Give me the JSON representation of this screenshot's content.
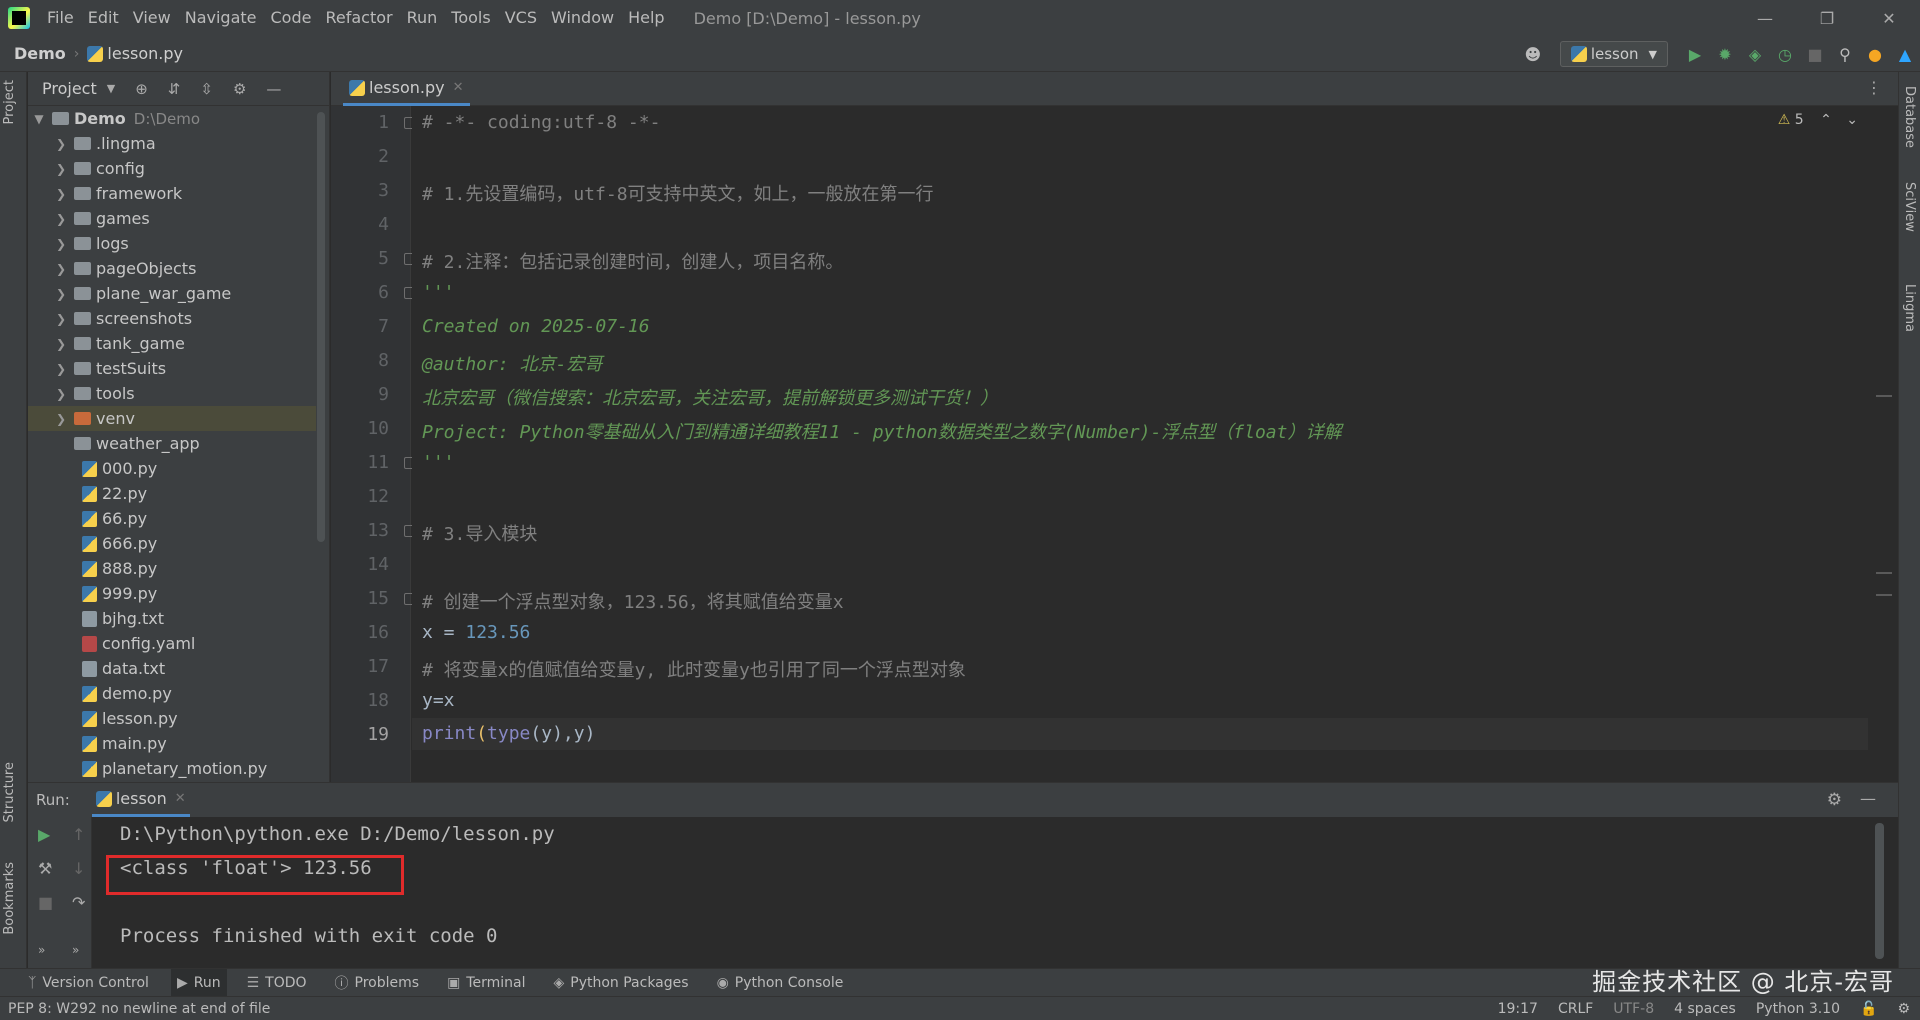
{
  "window": {
    "title": "Demo [D:\\Demo] - lesson.py",
    "menu": [
      "File",
      "Edit",
      "View",
      "Navigate",
      "Code",
      "Refactor",
      "Run",
      "Tools",
      "VCS",
      "Window",
      "Help"
    ]
  },
  "navbar": {
    "project": "Demo",
    "file": "lesson.py",
    "run_config": "lesson"
  },
  "left_strip": {
    "project": "Project",
    "structure": "Structure",
    "bookmarks": "Bookmarks"
  },
  "right_strip": {
    "database": "Database",
    "sciview": "SciView",
    "lingma": "Lingma"
  },
  "project_panel": {
    "title": "Project",
    "root_name": "Demo",
    "root_path": "D:\\Demo",
    "folders": [
      ".lingma",
      "config",
      "framework",
      "games",
      "logs",
      "pageObjects",
      "plane_war_game",
      "screenshots",
      "tank_game",
      "testSuits",
      "tools",
      "venv",
      "weather_app"
    ],
    "files": [
      "000.py",
      "22.py",
      "66.py",
      "666.py",
      "888.py",
      "999.py",
      "bjhg.txt",
      "config.yaml",
      "data.txt",
      "demo.py",
      "lesson.py",
      "main.py",
      "planetary_motion.py"
    ]
  },
  "editor": {
    "tab": "lesson.py",
    "warnings": "5",
    "line_numbers": [
      "1",
      "2",
      "3",
      "4",
      "5",
      "6",
      "7",
      "8",
      "9",
      "10",
      "11",
      "12",
      "13",
      "14",
      "15",
      "16",
      "17",
      "18",
      "19"
    ],
    "lines": {
      "l1": "# -*- coding:utf-8 -*-",
      "l3": "# 1.先设置编码，utf-8可支持中英文，如上，一般放在第一行",
      "l5": "# 2.注释：包括记录创建时间，创建人，项目名称。",
      "l6": "'''",
      "l7": "Created on 2025-07-16",
      "l8": "@author: 北京-宏哥",
      "l9": "北京宏哥（微信搜索：北京宏哥，关注宏哥，提前解锁更多测试干货！）",
      "l10": "Project: Python零基础从入门到精通详细教程11 - python数据类型之数字(Number)-浮点型（float）详解",
      "l11": "'''",
      "l13": "# 3.导入模块",
      "l15": "# 创建一个浮点型对象，123.56，将其赋值给变量x",
      "l16_var": "x = ",
      "l16_num": "123.56",
      "l17": "# 将变量x的值赋值给变量y, 此时变量y也引用了同一个浮点型对象",
      "l18": "y=x",
      "l19_fn": "print",
      "l19_a": "(",
      "l19_type": "type",
      "l19_b": "(y),y)"
    }
  },
  "run_panel": {
    "label": "Run:",
    "tab": "lesson",
    "console": [
      "D:\\Python\\python.exe D:/Demo/lesson.py",
      "<class 'float'> 123.56",
      "",
      "Process finished with exit code 0"
    ]
  },
  "tool_windows": [
    "Version Control",
    "Run",
    "TODO",
    "Problems",
    "Terminal",
    "Python Packages",
    "Python Console"
  ],
  "status": {
    "message": "PEP 8: W292 no newline at end of file",
    "position": "19:17",
    "line_sep": "CRLF",
    "encoding": "UTF-8",
    "indent": "4 spaces",
    "interpreter": "Python 3.10"
  },
  "watermark": "掘金技术社区 @ 北京-宏哥",
  "colors": {
    "accent": "#4a88c7",
    "highlight_box": "#e02b2b",
    "comment": "#808080",
    "docstring": "#629755",
    "number": "#6897bb"
  }
}
